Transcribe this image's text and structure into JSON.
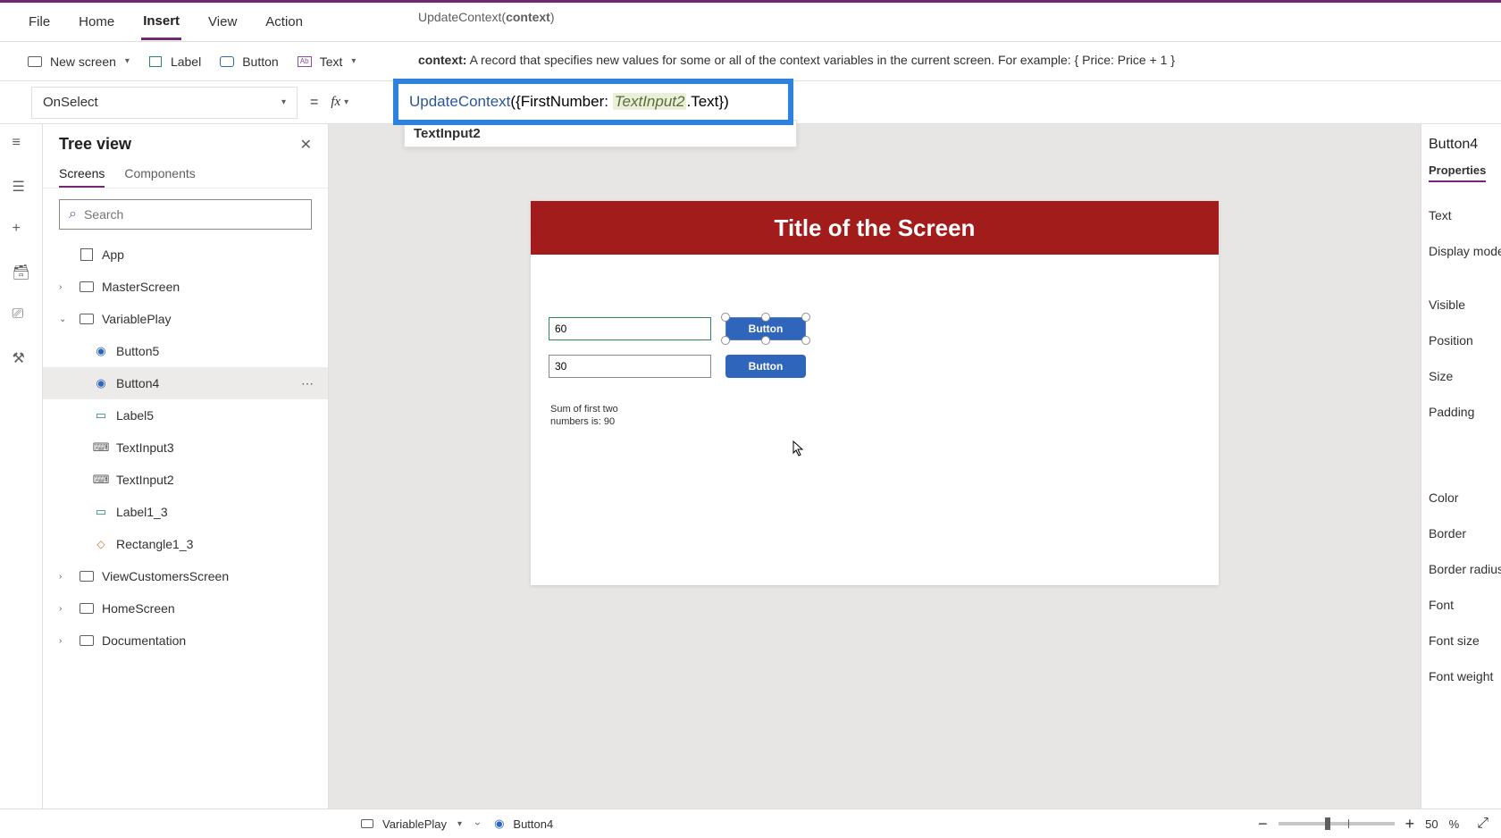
{
  "menu": {
    "file": "File",
    "home": "Home",
    "insert": "Insert",
    "view": "View",
    "action": "Action"
  },
  "tooltip": {
    "fn": "UpdateContext(",
    "arg": "context",
    "close": ")"
  },
  "contextHint": {
    "label": "context:",
    "desc": " A record that specifies new values for some or all of the context variables in the current screen. For example: { Price: Price + 1 }"
  },
  "ribbon": {
    "newScreen": "New screen",
    "label": "Label",
    "button": "Button",
    "text": "Text"
  },
  "propertySelect": "OnSelect",
  "equals": "=",
  "fx": "fx",
  "formula": {
    "fn": "UpdateContext",
    "open": "({FirstNumber: ",
    "ref": "TextInput2",
    "rest": ".Text})"
  },
  "suggest": "TextInput2",
  "treeView": {
    "title": "Tree view",
    "tabs": {
      "screens": "Screens",
      "components": "Components"
    },
    "searchPlaceholder": "Search",
    "nodes": {
      "app": "App",
      "master": "MasterScreen",
      "variable": "VariablePlay",
      "button5": "Button5",
      "button4": "Button4",
      "label5": "Label5",
      "textInput3": "TextInput3",
      "textInput2": "TextInput2",
      "label1_3": "Label1_3",
      "rectangle1_3": "Rectangle1_3",
      "viewCustomers": "ViewCustomersScreen",
      "homeScreen": "HomeScreen",
      "documentation": "Documentation"
    }
  },
  "canvas": {
    "title": "Title of the Screen",
    "input1": "60",
    "input2": "30",
    "buttonLabel": "Button",
    "sumLine1": "Sum of first two",
    "sumLine2": "numbers is: 90"
  },
  "propsPanel": {
    "selected": "Button4",
    "tab": "Properties",
    "rows": [
      "Text",
      "Display mode",
      "Visible",
      "Position",
      "Size",
      "Padding",
      "Color",
      "Border",
      "Border radius",
      "Font",
      "Font size",
      "Font weight"
    ]
  },
  "status": {
    "screen": "VariablePlay",
    "control": "Button4",
    "zoomPct": "50",
    "pctSign": "%"
  }
}
